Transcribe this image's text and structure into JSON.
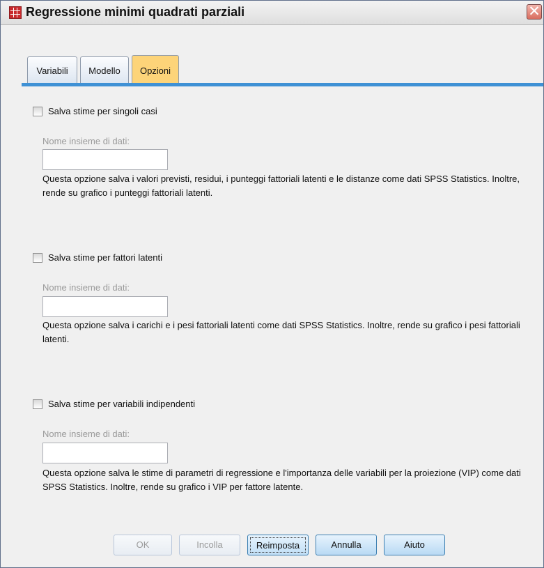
{
  "window": {
    "title": "Regressione minimi quadrati parziali"
  },
  "tabs": [
    {
      "label": "Variabili",
      "active": false
    },
    {
      "label": "Modello",
      "active": false
    },
    {
      "label": "Opzioni",
      "active": true
    }
  ],
  "sections": [
    {
      "checkbox_label": "Salva stime per singoli casi",
      "checked": false,
      "dataset_label": "Nome insieme di dati:",
      "dataset_value": "",
      "description": "Questa opzione salva i valori previsti, residui, i punteggi fattoriali latenti e le distanze come dati SPSS  Statistics. Inoltre, rende su grafico i punteggi fattoriali latenti."
    },
    {
      "checkbox_label": "Salva stime per fattori latenti",
      "checked": false,
      "dataset_label": "Nome insieme di dati:",
      "dataset_value": "",
      "description": "Questa opzione salva i carichi e i pesi fattoriali latenti come dati SPSS  Statistics. Inoltre, rende su grafico i pesi fattoriali latenti."
    },
    {
      "checkbox_label": "Salva stime per variabili indipendenti",
      "checked": false,
      "dataset_label": "Nome insieme di dati:",
      "dataset_value": "",
      "description": "Questa opzione salva le stime di parametri di regressione e l'importanza delle variabili per la proiezione (VIP) come dati SPSS  Statistics. Inoltre, rende su grafico i VIP per fattore latente."
    }
  ],
  "buttons": {
    "ok": "OK",
    "paste": "Incolla",
    "reset": "Reimposta",
    "cancel": "Annulla",
    "help": "Aiuto"
  },
  "icons": {
    "app": "spss-grid-icon",
    "close": "close-icon"
  },
  "colors": {
    "active_tab": "#fdd479",
    "tab_underline": "#3f91d5",
    "close_button": "#d96d5f"
  }
}
